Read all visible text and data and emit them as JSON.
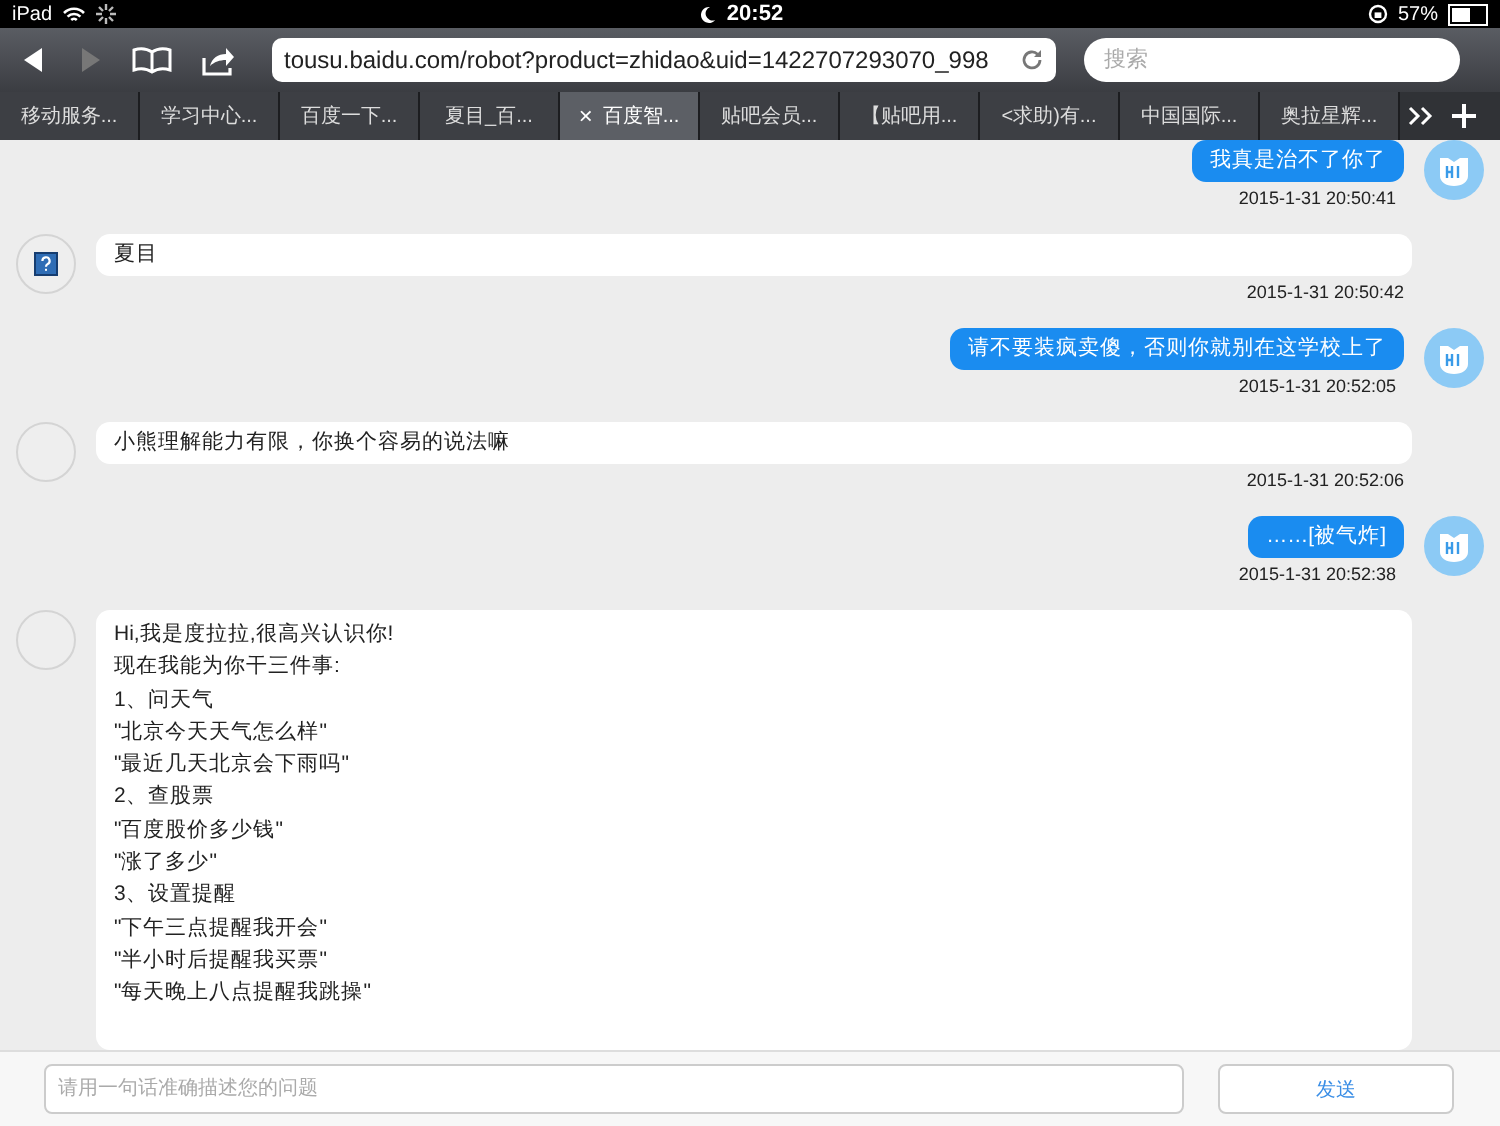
{
  "status_bar": {
    "device": "iPad",
    "time": "20:52",
    "battery": "57%"
  },
  "toolbar": {
    "url": "tousu.baidu.com/robot?product=zhidao&uid=1422707293070_998",
    "search_placeholder": "搜索"
  },
  "tabs": [
    {
      "label": "移动服务...",
      "selected": false
    },
    {
      "label": "学习中心...",
      "selected": false
    },
    {
      "label": "百度一下...",
      "selected": false
    },
    {
      "label": "夏目_百...",
      "selected": false
    },
    {
      "label": "百度智...",
      "selected": true,
      "close": "×"
    },
    {
      "label": "贴吧会员...",
      "selected": false
    },
    {
      "label": "【贴吧用...",
      "selected": false
    },
    {
      "label": "<求助)有...",
      "selected": false
    },
    {
      "label": "中国国际...",
      "selected": false
    },
    {
      "label": "奥拉星辉...",
      "selected": false
    }
  ],
  "messages": [
    {
      "kind": "user",
      "lines": [
        "我真是治不了你了"
      ],
      "time": "2015-1-31 20:50:41"
    },
    {
      "kind": "bot",
      "avatar_icon": true,
      "lines": [
        "夏目"
      ],
      "time": "2015-1-31 20:50:42"
    },
    {
      "kind": "user",
      "lines": [
        "请不要装疯卖傻，否则你就别在这学校上了"
      ],
      "time": "2015-1-31 20:52:05"
    },
    {
      "kind": "bot",
      "avatar_icon": false,
      "lines": [
        "小熊理解能力有限，你换个容易的说法嘛"
      ],
      "time": "2015-1-31 20:52:06"
    },
    {
      "kind": "user",
      "lines": [
        "……[被气炸]"
      ],
      "time": "2015-1-31 20:52:38"
    },
    {
      "kind": "bot",
      "avatar_icon": false,
      "lines": [
        "Hi,我是度拉拉,很高兴认识你!",
        "现在我能为你干三件事:",
        "1、问天气",
        "\"北京今天天气怎么样\"",
        "\"最近几天北京会下雨吗\"",
        "2、查股票",
        "\"百度股价多少钱\"",
        "\"涨了多少\"",
        "3、设置提醒",
        "\"下午三点提醒我开会\"",
        "\"半小时后提醒我买票\"",
        "\"每天晚上八点提醒我跳操\""
      ]
    }
  ],
  "input": {
    "placeholder": "请用一句话准确描述您的问题",
    "send_label": "发送"
  }
}
